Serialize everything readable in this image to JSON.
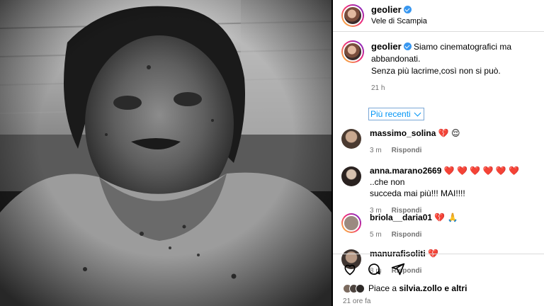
{
  "post": {
    "author": "geolier",
    "location": "Vele di Scampia",
    "caption_line1": "Siamo cinematografici ma abbandonati.",
    "caption_line2": "Senza più lacrime,così non si può.",
    "caption_time": "21 h",
    "sort_label": "Più recenti"
  },
  "comments": [
    {
      "user": "massimo_solina",
      "text": "💔 😌",
      "time": "3 m",
      "reply": "Rispondi"
    },
    {
      "user": "anna.marano2669",
      "text": "❤️ ❤️ ❤️ ❤️ ❤️ ❤️ ..che non",
      "text2": "succeda mai più!!! MAI!!!!",
      "time": "3 m",
      "reply": "Rispondi"
    },
    {
      "user": "briola__daria01",
      "text": "💔 🙏",
      "time": "5 m",
      "reply": "Rispondi"
    },
    {
      "user": "manurafisoliti",
      "text": "💔",
      "time": "8 m",
      "reply": "Rispondi"
    }
  ],
  "footer": {
    "likes_prefix": "Piace a",
    "likes_user": "silvia.zollo",
    "likes_suffix": "e altri",
    "post_time": "21 ore fa"
  },
  "icons": [
    "heart-icon",
    "comment-icon",
    "share-icon",
    "verified-badge-icon",
    "chevron-down-icon"
  ],
  "colors": {
    "link_blue": "#0095f6",
    "verified_blue": "#3897f0",
    "meta_gray": "#737373"
  }
}
